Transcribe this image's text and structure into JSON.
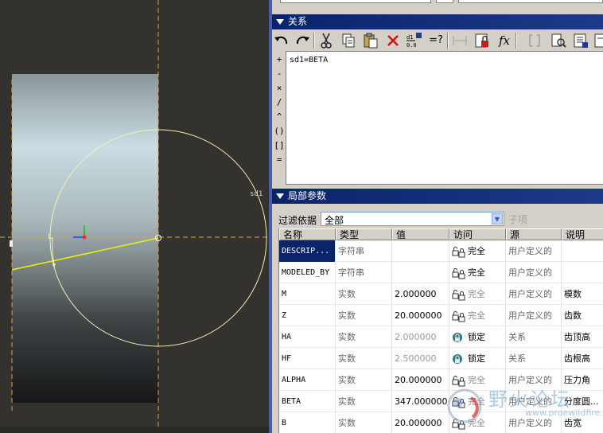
{
  "viewport": {
    "dimension_label": "sd1"
  },
  "relations": {
    "title": "关系",
    "toolbar": [
      "undo-icon",
      "redo-icon",
      "cut-icon",
      "copy-icon",
      "paste-icon",
      "delete-icon",
      "switch-dims-icon",
      "equals-query-icon",
      "dimension-icon",
      "lock-icon",
      "function-icon",
      "parens-icon",
      "verify-icon",
      "sort-icon",
      "list-icon"
    ],
    "function_label": "fx",
    "check_label": "=?",
    "operators": [
      "+",
      "-",
      "×",
      "/",
      "^",
      "()",
      "[]",
      "="
    ],
    "text": "sd1=BETA"
  },
  "local_params": {
    "title": "局部参数",
    "filter_label": "过滤依据",
    "filter_value": "全部",
    "sub_button": "子项",
    "columns": [
      "名称",
      "类型",
      "值",
      "访问",
      "源",
      "说明"
    ],
    "rows": [
      {
        "name": "DESCRIP...",
        "type": "字符串",
        "value": "",
        "access": "完全",
        "source": "用户定义的",
        "desc": "",
        "selected": true
      },
      {
        "name": "MODELED_BY",
        "type": "字符串",
        "value": "",
        "access": "完全",
        "source": "用户定义的",
        "desc": ""
      },
      {
        "name": "M",
        "type": "实数",
        "value": "2.000000",
        "access": "完全",
        "source": "用户定义的",
        "desc": "模数"
      },
      {
        "name": "Z",
        "type": "实数",
        "value": "20.000000",
        "access": "完全",
        "source": "用户定义的",
        "desc": "齿数"
      },
      {
        "name": "HA",
        "type": "实数",
        "value": "2.000000",
        "access": "锁定",
        "source": "关系",
        "desc": "齿顶高"
      },
      {
        "name": "HF",
        "type": "实数",
        "value": "2.500000",
        "access": "锁定",
        "source": "关系",
        "desc": "齿根高"
      },
      {
        "name": "ALPHA",
        "type": "实数",
        "value": "20.000000",
        "access": "完全",
        "source": "用户定义的",
        "desc": "压力角"
      },
      {
        "name": "BETA",
        "type": "实数",
        "value": "347.000000",
        "access": "完全",
        "source": "用户定义的",
        "desc": "分度圆..."
      },
      {
        "name": "B",
        "type": "实数",
        "value": "20.000000",
        "access": "完全",
        "source": "用户定义的",
        "desc": "齿宽"
      }
    ]
  },
  "watermark": {
    "text": "野火论坛",
    "url": "www.proewildfire.cn"
  }
}
